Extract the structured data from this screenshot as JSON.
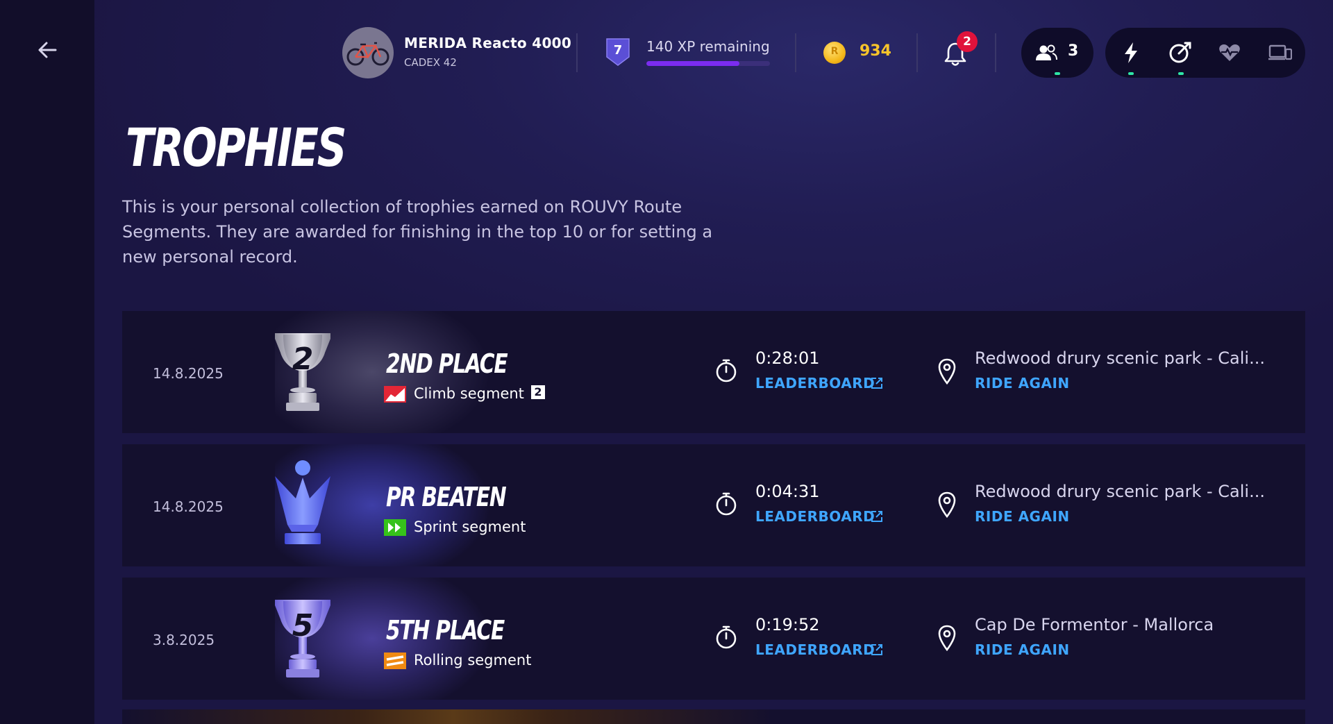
{
  "header": {
    "bike_name": "MERIDA Reacto 4000",
    "bike_wheels": "CADEX 42",
    "level": "7",
    "xp_text": "140 XP remaining",
    "xp_progress": 0.75,
    "coins": "934",
    "coin_symbol": "R",
    "notifications": "2",
    "friends_online": "3",
    "sensor_icons": [
      "lightning-icon",
      "cadence-icon",
      "heart-rate-icon",
      "devices-icon"
    ]
  },
  "page": {
    "title": "TROPHIES",
    "intro": "This is your personal collection of trophies earned on ROUVY Route Segments. They are awarded for finishing in the top 10 or for setting a new personal record."
  },
  "trophies": [
    {
      "date": "14.8.2025",
      "trophy_type": "silver-2nd",
      "rank_glyph": "2",
      "title": "2ND PLACE",
      "segment": "Climb segment",
      "segment_badge": "2",
      "segment_color": "#e32636",
      "time": "0:28:01",
      "leaderboard": "LEADERBOARD",
      "route": "Redwood drury scenic park - Cali...",
      "ride_again": "RIDE AGAIN"
    },
    {
      "date": "14.8.2025",
      "trophy_type": "pr-blue",
      "title": "PR BEATEN",
      "segment": "Sprint segment",
      "segment_color": "#36c21a",
      "time": "0:04:31",
      "leaderboard": "LEADERBOARD",
      "route": "Redwood drury scenic park - Cali...",
      "ride_again": "RIDE AGAIN"
    },
    {
      "date": "3.8.2025",
      "trophy_type": "purple-5th",
      "rank_glyph": "5",
      "title": "5TH PLACE",
      "segment": "Rolling segment",
      "segment_color": "#f08a12",
      "time": "0:19:52",
      "leaderboard": "LEADERBOARD",
      "route": "Cap De Formentor - Mallorca",
      "ride_again": "RIDE AGAIN"
    }
  ]
}
